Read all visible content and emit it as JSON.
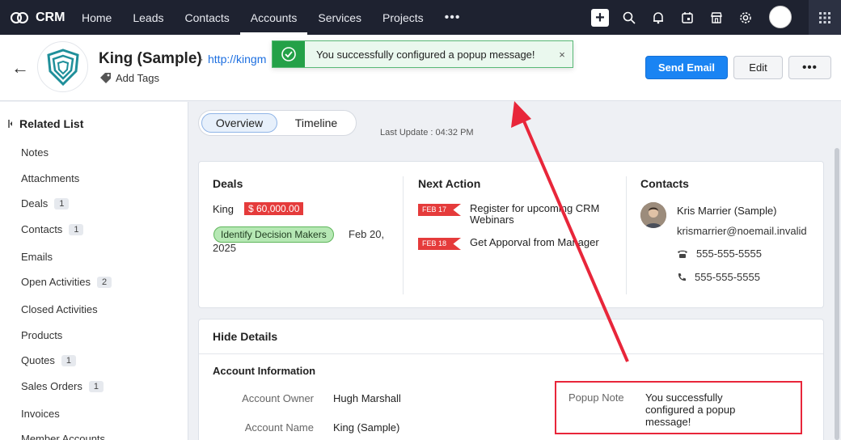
{
  "nav": {
    "brand": "CRM",
    "links": [
      "Home",
      "Leads",
      "Contacts",
      "Accounts",
      "Services",
      "Projects"
    ],
    "active": "Accounts",
    "more": "•••",
    "icons": [
      "plus-icon",
      "search-icon",
      "bell-icon",
      "calendar-icon",
      "store-icon",
      "gear-icon"
    ]
  },
  "record": {
    "back": "←",
    "title": "King (Sample)",
    "separator": "-",
    "url": "http://kingm",
    "add_tags": "Add Tags",
    "send_email": "Send Email",
    "edit": "Edit",
    "more": "•••"
  },
  "toast": {
    "message": "You successfully configured a popup message!",
    "close": "×"
  },
  "sidebar": {
    "title": "Related List",
    "items": [
      {
        "label": "Notes",
        "count": ""
      },
      {
        "label": "Attachments",
        "count": ""
      },
      {
        "label": "Deals",
        "count": "1"
      },
      {
        "label": "Contacts",
        "count": "1"
      },
      {
        "label": "Emails",
        "count": ""
      },
      {
        "label": "Open Activities",
        "count": "2"
      },
      {
        "label": "Closed Activities",
        "count": ""
      },
      {
        "label": "Products",
        "count": ""
      },
      {
        "label": "Quotes",
        "count": "1"
      },
      {
        "label": "Sales Orders",
        "count": "1"
      },
      {
        "label": "Invoices",
        "count": ""
      },
      {
        "label": "Member Accounts",
        "count": ""
      }
    ]
  },
  "tabs": {
    "overview": "Overview",
    "timeline": "Timeline",
    "last_update": "Last Update : 04:32 PM"
  },
  "deals": {
    "title": "Deals",
    "name": "King",
    "amount": "$ 60,000.00",
    "stage": "Identify Decision Makers",
    "date": "Feb 20, 2025"
  },
  "next_action": {
    "title": "Next Action",
    "items": [
      {
        "badge": "FEB 17",
        "text": "Register for upcoming CRM Webinars"
      },
      {
        "badge": "FEB 18",
        "text": "Get Apporval from Manager"
      }
    ]
  },
  "contacts": {
    "title": "Contacts",
    "name": "Kris Marrier (Sample)",
    "email": "krismarrier@noemail.invalid",
    "phone1": "555-555-5555",
    "phone2": "555-555-5555"
  },
  "details": {
    "hide_details": "Hide Details",
    "section": "Account Information",
    "fields": [
      {
        "label": "Account Owner",
        "value": "Hugh Marshall"
      },
      {
        "label": "Account Name",
        "value": "King (Sample)"
      }
    ],
    "popup_label": "Popup Note",
    "popup_value": "You successfully configured a popup message!"
  },
  "colors": {
    "nav_bg": "#1e2230",
    "primary": "#1a84f3",
    "amount_red": "#e53b3b",
    "stage_green": "#b6e8b4",
    "toast_green": "#24a148",
    "annotation_red": "#e8263a"
  }
}
